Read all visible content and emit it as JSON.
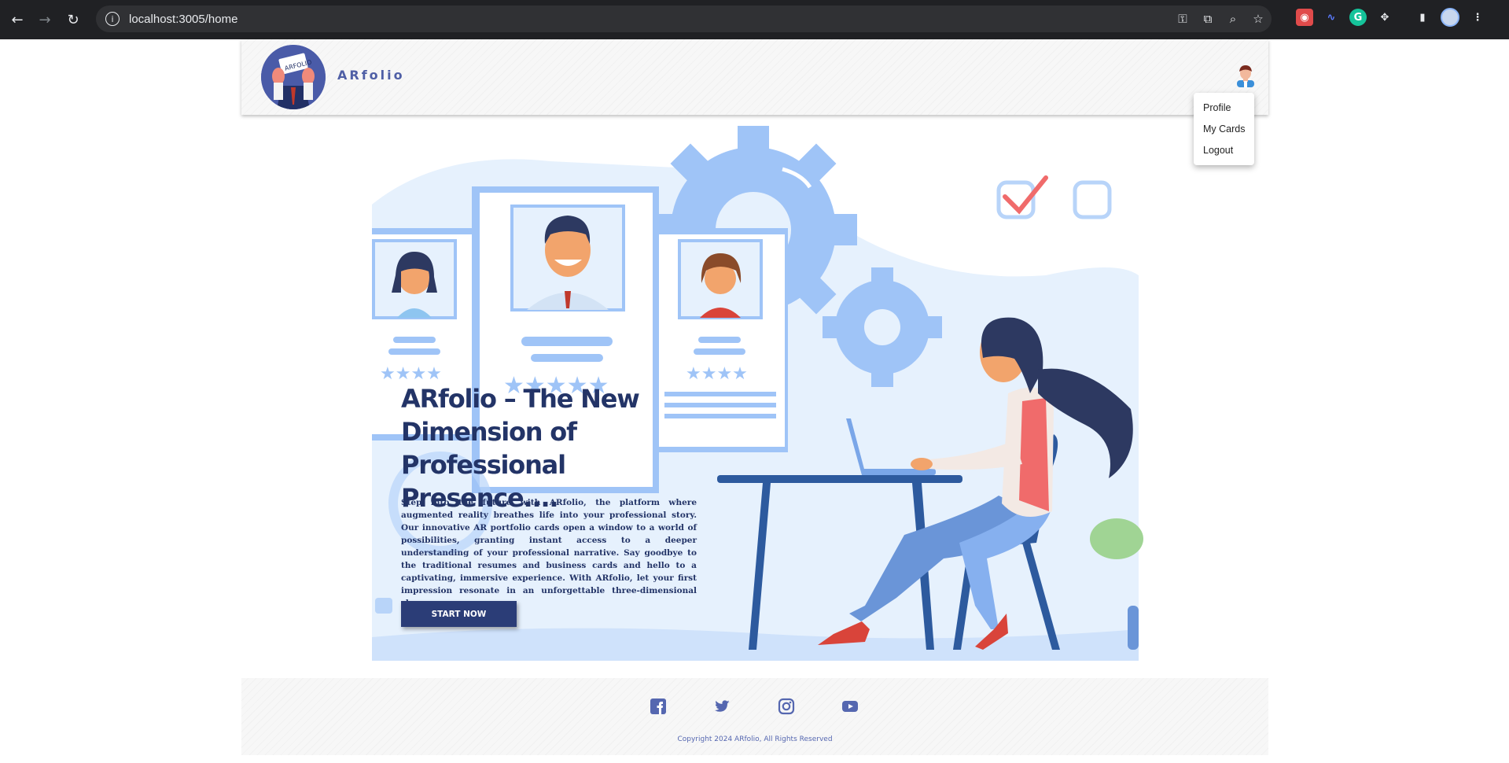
{
  "browser": {
    "url": "localhost:3005/home",
    "back_glyph": "←",
    "forward_glyph": "→",
    "reload_glyph": "↻"
  },
  "header": {
    "brand": "ARfolio",
    "logo_card_text": "ARFOLIO"
  },
  "user_menu": {
    "items": [
      "Profile",
      "My Cards",
      "Logout"
    ]
  },
  "hero": {
    "title": "ARfolio – The New Dimension of Professional Presence....",
    "description": "Step into the future with ARfolio, the platform where augmented reality breathes life into your professional story. Our innovative AR portfolio cards open a window to a world of possibilities, granting instant access to a deeper understanding of your professional narrative. Say goodbye to the traditional resumes and business cards and hello to a captivating, immersive experience. With ARfolio, let your first impression resonate in an unforgettable three-dimensional showcase.",
    "cta_label": "START NOW"
  },
  "footer": {
    "social": [
      "facebook-icon",
      "twitter-icon",
      "instagram-icon",
      "youtube-icon"
    ],
    "copyright": "Copyright 2024 ARfolio, All Rights Reserved"
  },
  "colors": {
    "primary_dark": "#233467",
    "button": "#2b3d77",
    "brand_text": "#4f5fa6",
    "illustration_light": "#e4f0fd",
    "illustration_blue": "#9fc4f7"
  }
}
